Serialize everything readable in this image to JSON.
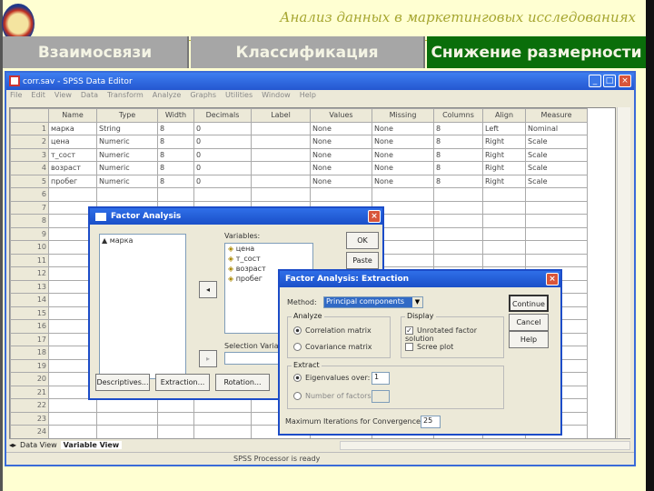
{
  "slide": {
    "title": "Анализ данных в маркетинговых исследованиях",
    "tabs": [
      {
        "label": "Взаимосвязи",
        "active": false
      },
      {
        "label": "Классификация",
        "active": false
      },
      {
        "label": "Снижение размерности",
        "active": true
      }
    ],
    "colors": {
      "active_tab": "#0a6e0a",
      "tab": "#a6a6a6",
      "background": "#ffffd2"
    }
  },
  "window": {
    "title": "corr.sav - SPSS Data Editor",
    "menu": [
      "File",
      "Edit",
      "View",
      "Data",
      "Transform",
      "Analyze",
      "Graphs",
      "Utilities",
      "Window",
      "Help"
    ],
    "columns": [
      "Name",
      "Type",
      "Width",
      "Decimals",
      "Label",
      "Values",
      "Missing",
      "Columns",
      "Align",
      "Measure"
    ],
    "rows": [
      [
        "марка",
        "String",
        "8",
        "0",
        "",
        "None",
        "None",
        "8",
        "Left",
        "Nominal"
      ],
      [
        "цена",
        "Numeric",
        "8",
        "0",
        "",
        "None",
        "None",
        "8",
        "Right",
        "Scale"
      ],
      [
        "т_сост",
        "Numeric",
        "8",
        "0",
        "",
        "None",
        "None",
        "8",
        "Right",
        "Scale"
      ],
      [
        "возраст",
        "Numeric",
        "8",
        "0",
        "",
        "None",
        "None",
        "8",
        "Right",
        "Scale"
      ],
      [
        "пробег",
        "Numeric",
        "8",
        "0",
        "",
        "None",
        "None",
        "8",
        "Right",
        "Scale"
      ]
    ],
    "row_count": 24,
    "sheet_tabs": [
      "Data View",
      "Variable View"
    ],
    "status": "SPSS Processor is ready"
  },
  "factor_dialog": {
    "title": "Factor Analysis",
    "source_vars": [
      "марка"
    ],
    "variables_label": "Variables:",
    "variables": [
      "цена",
      "т_сост",
      "возраст",
      "пробег"
    ],
    "selection_label": "Selection Variable:",
    "buttons": {
      "ok": "OK",
      "paste": "Paste",
      "descriptives": "Descriptives...",
      "extraction": "Extraction...",
      "rotation": "Rotation..."
    }
  },
  "extraction_dialog": {
    "title": "Factor Analysis: Extraction",
    "method_label": "Method:",
    "method": "Principal components",
    "analyze_label": "Analyze",
    "analyze_options": [
      "Correlation matrix",
      "Covariance matrix"
    ],
    "display_label": "Display",
    "display_options": [
      {
        "label": "Unrotated factor solution",
        "checked": true
      },
      {
        "label": "Scree plot",
        "checked": false
      }
    ],
    "extract_label": "Extract",
    "eigen_label": "Eigenvalues over:",
    "eigen_value": "1",
    "number_label": "Number of factors:",
    "iterations_label": "Maximum Iterations for Convergence:",
    "iterations": "25",
    "buttons": {
      "continue": "Continue",
      "cancel": "Cancel",
      "help": "Help"
    }
  }
}
